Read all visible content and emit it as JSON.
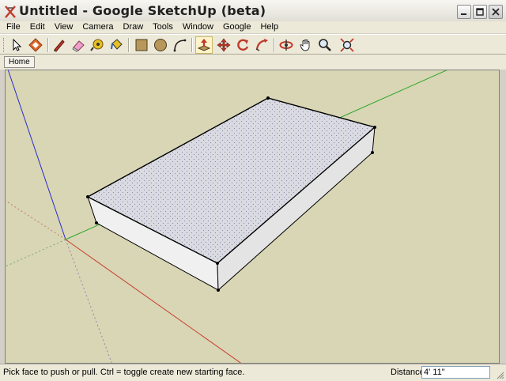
{
  "window": {
    "title": "Untitled - Google SketchUp (beta)",
    "app_icon": "sketchup-logo-icon",
    "buttons": [
      "minimize-icon",
      "maximize-icon",
      "close-icon"
    ]
  },
  "menu": {
    "items": [
      "File",
      "Edit",
      "View",
      "Camera",
      "Draw",
      "Tools",
      "Window",
      "Google",
      "Help"
    ]
  },
  "toolbar": {
    "tools": [
      "select-arrow-icon",
      "make-component-icon",
      "pencil-line-icon",
      "eraser-icon",
      "tape-measure-icon",
      "paint-bucket-icon",
      "rectangle-icon",
      "circle-icon",
      "arc-icon",
      "push-pull-icon",
      "move-icon",
      "rotate-icon",
      "follow-me-icon",
      "orbit-icon",
      "pan-hand-icon",
      "zoom-icon",
      "zoom-extents-icon"
    ],
    "active_tool": "push-pull-icon"
  },
  "scenes": {
    "tabs": [
      "Home"
    ]
  },
  "viewport": {
    "background": "#d8d6b4",
    "axis_colors": {
      "red": "#c83c2e",
      "green": "#2aa62a",
      "blue": "#2b2bd1"
    },
    "face_top": "#d6d6df",
    "face_front": "#ebebeb"
  },
  "status": {
    "message": "Pick face to push or pull.  Ctrl = toggle create new starting face.",
    "measurement_label": "Distance",
    "measurement_value": "4' 11\""
  }
}
